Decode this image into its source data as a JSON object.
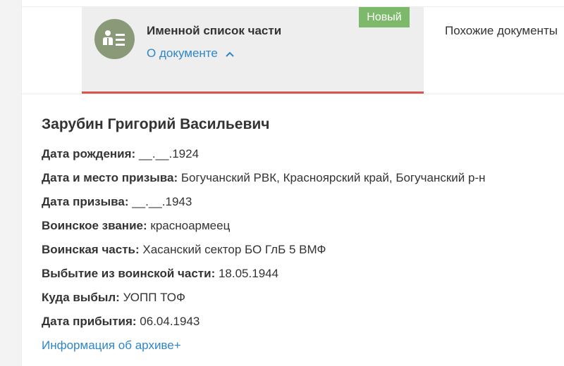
{
  "doc": {
    "badge": "Новый",
    "title": "Именной список части",
    "about_link": "О документе",
    "icon": "list-person-icon",
    "icon_color": "#8a9a78",
    "accent_color": "#d9534f",
    "badge_color": "#7cb96a",
    "link_color": "#2f86c8"
  },
  "similar_docs": "Похожие документы",
  "person": {
    "name": "Зарубин Григорий Васильевич",
    "fields": [
      {
        "label": "Дата рождения:",
        "value": "__.__.1924"
      },
      {
        "label": "Дата и место призыва:",
        "value": "Богучанский РВК, Красноярский край, Богучанский р-н"
      },
      {
        "label": "Дата призыва:",
        "value": "__.__.1943"
      },
      {
        "label": "Воинское звание:",
        "value": "красноармеец"
      },
      {
        "label": "Воинская часть:",
        "value": "Хасанский сектор БО ГлБ 5 ВМФ"
      },
      {
        "label": "Выбытие из воинской части:",
        "value": "18.05.1944"
      },
      {
        "label": "Куда выбыл:",
        "value": "УОПП ТОФ"
      },
      {
        "label": "Дата прибытия:",
        "value": "06.04.1943"
      }
    ],
    "archive_link": "Информация об архиве+"
  }
}
